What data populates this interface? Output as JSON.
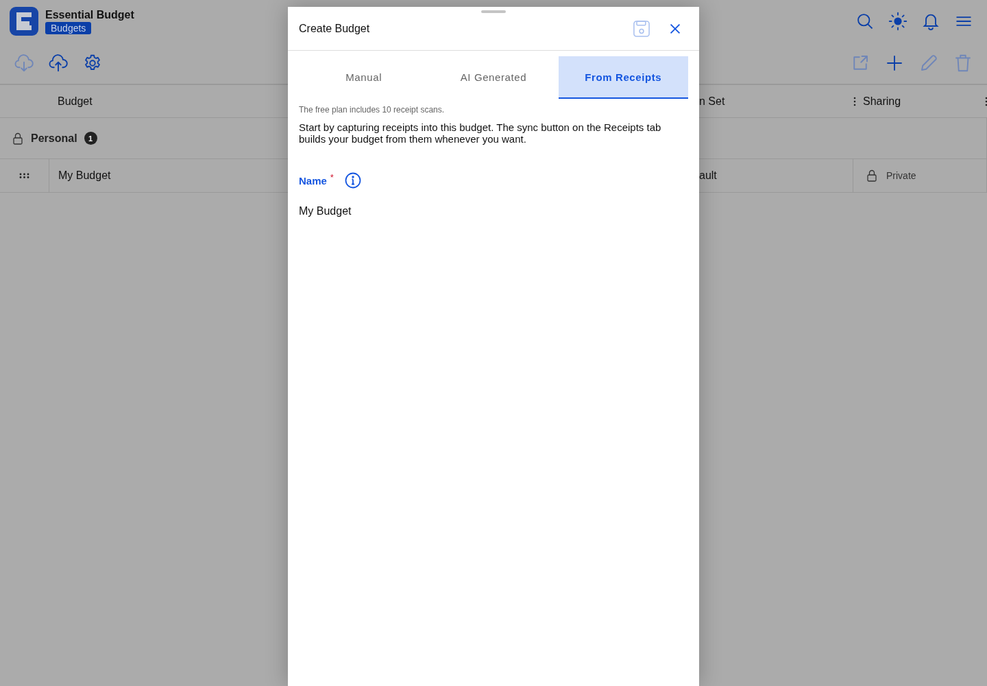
{
  "app": {
    "title": "Essential Budget",
    "badge": "Budgets"
  },
  "toolbar_left": [
    {
      "kind": "cloud-download",
      "disabled": true
    },
    {
      "kind": "cloud-upload",
      "disabled": false
    },
    {
      "kind": "settings",
      "disabled": false
    }
  ],
  "toolbar_right": [
    {
      "kind": "export",
      "disabled": true
    },
    {
      "kind": "add",
      "disabled": false
    },
    {
      "kind": "edit",
      "disabled": true
    },
    {
      "kind": "delete",
      "disabled": true
    }
  ],
  "table": {
    "columns": [
      "Budget",
      "n Set",
      "Sharing"
    ],
    "groups": [
      {
        "name": "Personal",
        "count": "1",
        "rows": [
          {
            "name": "My Budget",
            "column_2": "ault",
            "sharing": "Private"
          }
        ]
      }
    ]
  },
  "dialog": {
    "title": "Create Budget",
    "save_disabled": true,
    "tabs": [
      {
        "label": "Manual",
        "selected": false
      },
      {
        "label": "AI Generated",
        "selected": false
      },
      {
        "label": "From Receipts",
        "selected": true
      }
    ],
    "note": "The free plan includes 10 receipt scans.",
    "description": "Start by capturing receipts into this budget. The sync button on the Receipts tab builds your budget from them whenever you want.",
    "field": {
      "label": "Name",
      "required_mark": "*",
      "value": "My Budget"
    }
  }
}
